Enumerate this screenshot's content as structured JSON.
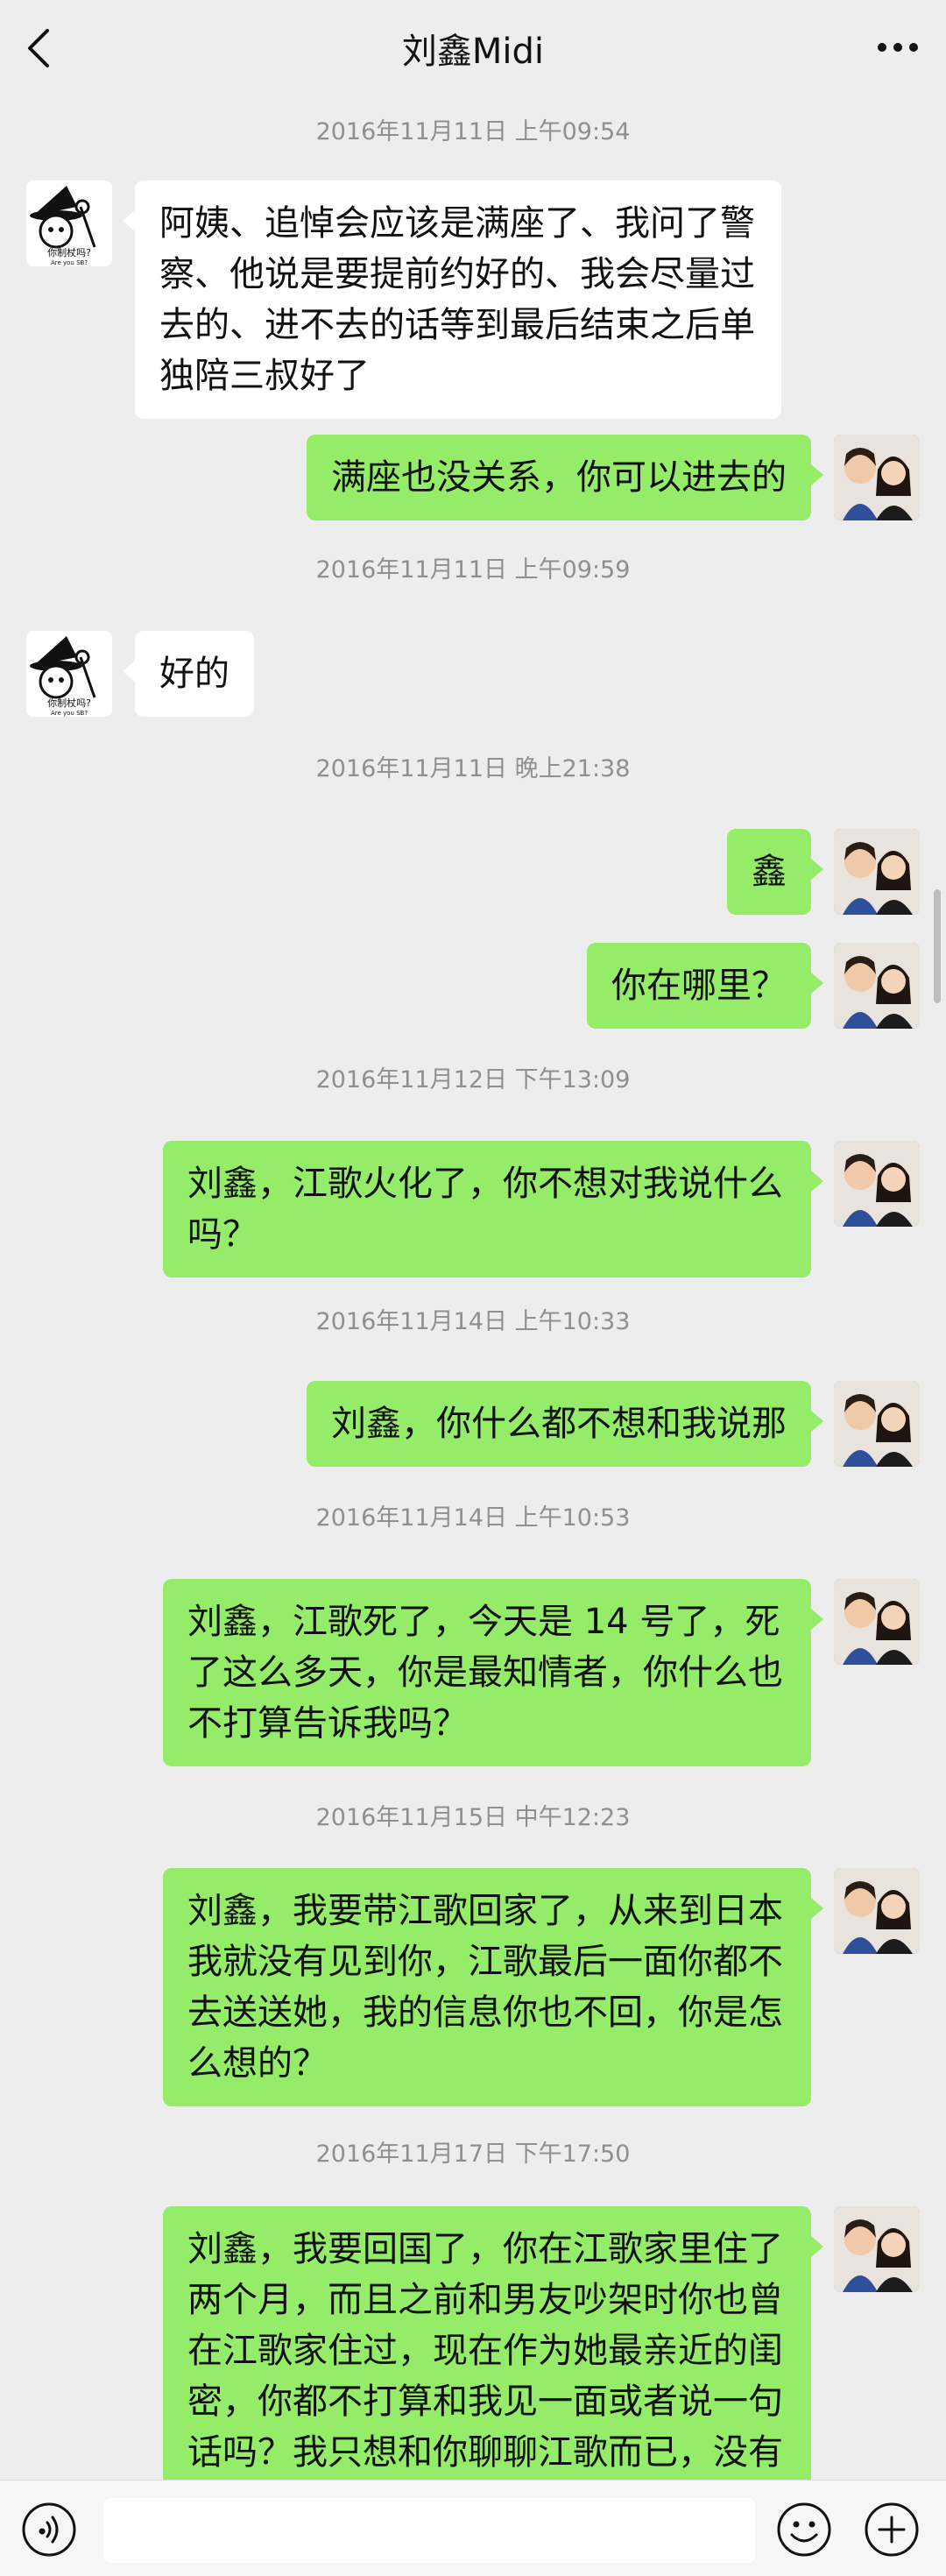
{
  "header": {
    "title": "刘鑫Midi"
  },
  "left_avatar": {
    "line1": "你制杖吗?",
    "line2": "Are you SB?"
  },
  "messages": [
    {
      "side": "ts",
      "text": "2016年11月11日 上午09:54"
    },
    {
      "side": "left",
      "text": "阿姨、追悼会应该是满座了、我问了警察、他说是要提前约好的、我会尽量过去的、进不去的话等到最后结束之后单独陪三叔好了"
    },
    {
      "side": "right",
      "text": "满座也没关系，你可以进去的"
    },
    {
      "side": "ts",
      "text": "2016年11月11日 上午09:59"
    },
    {
      "side": "left",
      "text": "好的"
    },
    {
      "side": "ts",
      "text": "2016年11月11日 晚上21:38"
    },
    {
      "side": "right",
      "text": "鑫"
    },
    {
      "side": "right",
      "text": "你在哪里？"
    },
    {
      "side": "ts",
      "text": "2016年11月12日 下午13:09"
    },
    {
      "side": "right",
      "text": "刘鑫，江歌火化了，你不想对我说什么吗？"
    },
    {
      "side": "ts",
      "text": "2016年11月14日 上午10:33"
    },
    {
      "side": "right",
      "text": "刘鑫，你什么都不想和我说那"
    },
    {
      "side": "ts",
      "text": "2016年11月14日 上午10:53"
    },
    {
      "side": "right",
      "text": "刘鑫，江歌死了，今天是 14 号了，死了这么多天，你是最知情者，你什么也不打算告诉我吗？"
    },
    {
      "side": "ts",
      "text": "2016年11月15日 中午12:23"
    },
    {
      "side": "right",
      "text": "刘鑫，我要带江歌回家了，从来到日本我就没有见到你，江歌最后一面你都不去送送她，我的信息你也不回，你是怎么想的？"
    },
    {
      "side": "ts",
      "text": "2016年11月17日 下午17:50"
    },
    {
      "side": "right",
      "text": "刘鑫，我要回国了，你在江歌家里住了两个月，而且之前和男友吵架时你也曾在江歌家住过，现在作为她最亲近的闺密，你都不打算和我见一面或者说一句话吗？我只想和你聊聊江歌而已，没有别的意思"
    }
  ],
  "input": {
    "value": ""
  },
  "colors": {
    "background": "#ededed",
    "sent_bubble": "#95ec69",
    "received_bubble": "#ffffff"
  }
}
